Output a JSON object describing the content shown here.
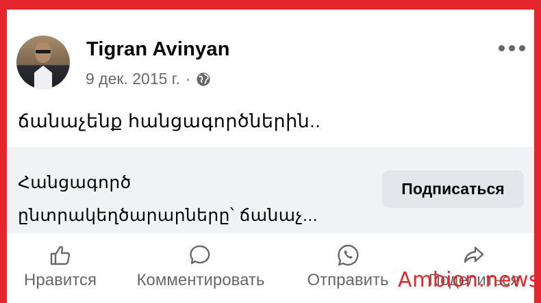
{
  "post": {
    "author": "Tigran Avinyan",
    "date": "9 дек. 2015 г.",
    "separator": "·",
    "privacy_icon": "globe-icon",
    "more_icon": "more-dots-icon",
    "text": "ճանաչենք հանցագործներին.."
  },
  "link_card": {
    "title_line1": "Հանցագործ",
    "title_line2": "ընտրակեղծարարները՝ ճանաչ...",
    "follow_label": "Подписаться"
  },
  "actions": [
    {
      "label": "Нравится",
      "icon": "like-icon"
    },
    {
      "label": "Комментировать",
      "icon": "comment-icon"
    },
    {
      "label": "Отправить",
      "icon": "whatsapp-icon"
    },
    {
      "label": "Поделиться",
      "icon": "share-icon"
    }
  ],
  "watermark": "Ambion.news",
  "colors": {
    "frame": "#e3262b",
    "secondary_text": "#65676b",
    "card_bg": "#f0f2f5",
    "button_bg": "#e4e6eb"
  }
}
